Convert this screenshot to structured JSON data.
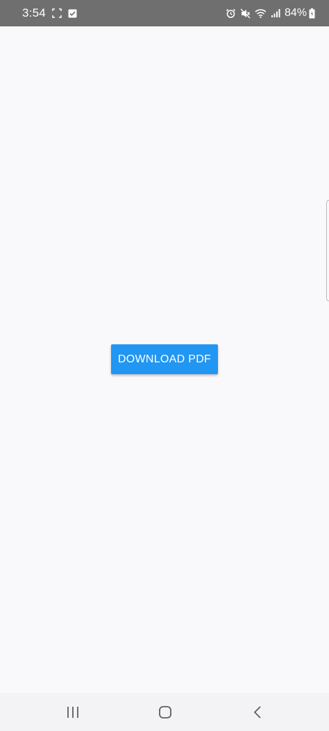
{
  "status_bar": {
    "time": "3:54",
    "battery": "84%",
    "icons": [
      "screenshot-icon",
      "checkbox-notification-icon",
      "alarm-icon",
      "mute-icon",
      "wifi-icon",
      "signal-icon",
      "battery-icon"
    ]
  },
  "main": {
    "button_label": "DOWNLOAD PDF"
  },
  "nav_bar": {
    "icons": [
      "recent-apps-icon",
      "home-icon",
      "back-icon"
    ]
  },
  "colors": {
    "accent": "#2196f3",
    "status_bar": "#6f6f6f",
    "background": "#f9f8fa",
    "nav_bar": "#f3f2f4"
  }
}
